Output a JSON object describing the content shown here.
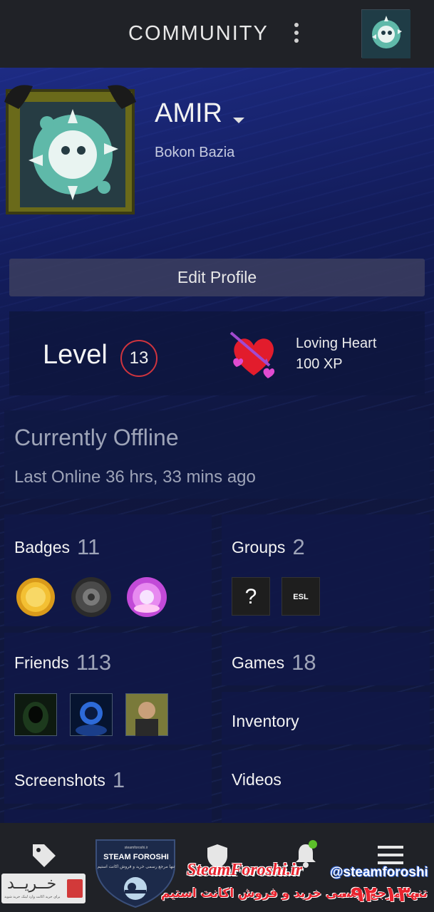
{
  "header": {
    "title": "COMMUNITY",
    "more_icon": "more-vertical-icon",
    "avatar_icon": "user-avatar-icon"
  },
  "profile": {
    "username": "AMIR",
    "real_name": "Bokon Bazia",
    "edit_button": "Edit Profile"
  },
  "level": {
    "label": "Level",
    "value": "13",
    "badge_name": "Loving Heart",
    "badge_xp": "100 XP"
  },
  "status": {
    "title": "Currently Offline",
    "last_online": "Last Online 36 hrs, 33 mins ago"
  },
  "tiles": {
    "badges": {
      "label": "Badges",
      "count": "11"
    },
    "groups": {
      "label": "Groups",
      "count": "2",
      "items": [
        "?",
        "ESL"
      ]
    },
    "friends": {
      "label": "Friends",
      "count": "113"
    },
    "games": {
      "label": "Games",
      "count": "18"
    },
    "inventory": {
      "label": "Inventory"
    },
    "screenshots": {
      "label": "Screenshots",
      "count": "1"
    },
    "videos": {
      "label": "Videos"
    }
  },
  "bottom_nav": {
    "items": [
      "tag-icon",
      "shield-icon",
      "bell-icon",
      "menu-icon"
    ]
  },
  "watermark": {
    "small_url": "steamforoshi.ir",
    "logo_title": "STEAM FOROSHI",
    "logo_sub": "تنها مرجع رسمی خرید و فروش اکانت استیم",
    "buy_label": "خــریــد",
    "buy_sub": "برای خرید اکانت وارد لینک خرید شوید",
    "site": "SteamForoshi.ir",
    "handle": "@steamforoshi",
    "slogan": "تنها مرجع رسمی خرید و فروش اکانت استیم",
    "phone": "۰۹۲ ۱۳۰ ۳۱۷۰"
  },
  "colors": {
    "accent_red": "#d0343e",
    "nav_bg": "#202227",
    "tile_bg": "#101846"
  }
}
